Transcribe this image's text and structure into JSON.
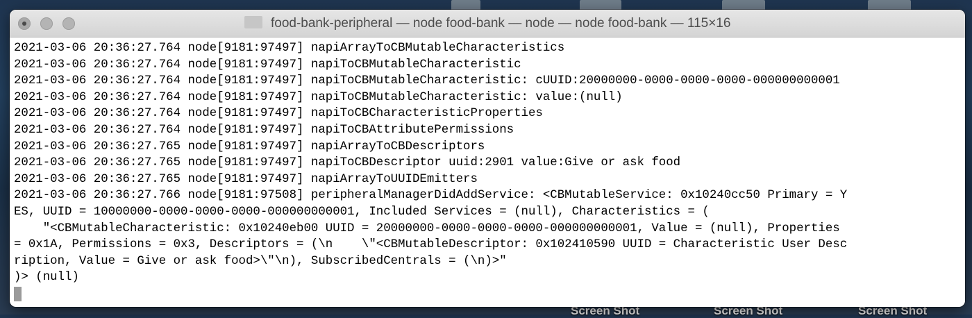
{
  "window": {
    "title": "food-bank-peripheral — node food-bank — node — node food-bank — 115×16"
  },
  "terminal": {
    "lines": [
      "2021-03-06 20:36:27.764 node[9181:97497] napiArrayToCBMutableCharacteristics",
      "2021-03-06 20:36:27.764 node[9181:97497] napiToCBMutableCharacteristic",
      "2021-03-06 20:36:27.764 node[9181:97497] napiToCBMutableCharacteristic: cUUID:20000000-0000-0000-0000-000000000001",
      "2021-03-06 20:36:27.764 node[9181:97497] napiToCBMutableCharacteristic: value:(null)",
      "2021-03-06 20:36:27.764 node[9181:97497] napiToCBCharacteristicProperties",
      "2021-03-06 20:36:27.764 node[9181:97497] napiToCBAttributePermissions",
      "2021-03-06 20:36:27.765 node[9181:97497] napiArrayToCBDescriptors",
      "2021-03-06 20:36:27.765 node[9181:97497] napiToCBDescriptor uuid:2901 value:Give or ask food",
      "2021-03-06 20:36:27.765 node[9181:97497] napiArrayToUUIDEmitters",
      "2021-03-06 20:36:27.766 node[9181:97508] peripheralManagerDidAddService: <CBMutableService: 0x10240cc50 Primary = Y",
      "ES, UUID = 10000000-0000-0000-0000-000000000001, Included Services = (null), Characteristics = (",
      "    \"<CBMutableCharacteristic: 0x10240eb00 UUID = 20000000-0000-0000-0000-000000000001, Value = (null), Properties",
      "= 0x1A, Permissions = 0x3, Descriptors = (\\n    \\\"<CBMutableDescriptor: 0x102410590 UUID = Characteristic User Desc",
      "ription, Value = Give or ask food>\\\"\\n), SubscribedCentrals = (\\n)>\"",
      ")> (null)"
    ]
  },
  "desktop": {
    "labels": [
      "Screen Shot",
      "Screen Shot",
      "Screen Shot"
    ]
  },
  "colors": {
    "titlebar": "#d9d9d9",
    "terminal_bg": "#ffffff",
    "terminal_fg": "#000000",
    "cursor": "#9a9a9a"
  }
}
